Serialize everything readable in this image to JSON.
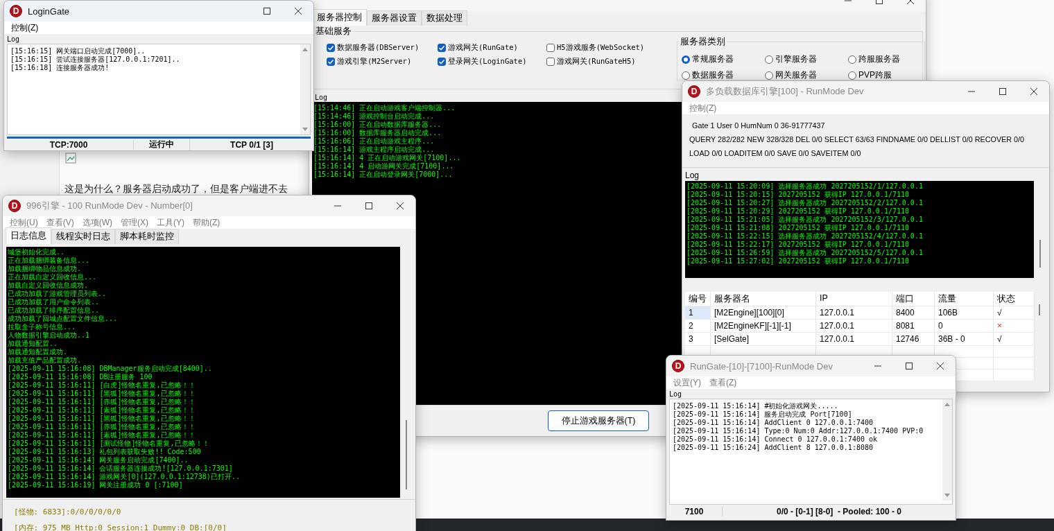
{
  "background_page": {
    "question": "这是为什么？服务器启动成功了，但是客户端进不去"
  },
  "game_center": {
    "minimize": true,
    "tabs": [
      {
        "label": "服务器控制",
        "selected": true
      },
      {
        "label": "服务器设置",
        "selected": false
      },
      {
        "label": "数据处理",
        "selected": false
      }
    ],
    "basic_group": {
      "title": "基础服务",
      "services": [
        {
          "label": "数据服务器(DBServer)",
          "checked": true
        },
        {
          "label": "游戏网关(RunGate)",
          "checked": true
        },
        {
          "label": "H5游戏服务(WebSocket)",
          "checked": false
        },
        {
          "label": "游戏引擎(M2Server)",
          "checked": true
        },
        {
          "label": "登录网关(LoginGate)",
          "checked": true
        },
        {
          "label": "游戏网关(RunGateH5)",
          "checked": false
        }
      ]
    },
    "type_group": {
      "title": "服务器类别",
      "options": [
        {
          "label": "常规服务器",
          "selected": true
        },
        {
          "label": "引擎服务器",
          "selected": false
        },
        {
          "label": "跨服服务器",
          "selected": false
        },
        {
          "label": "数据服务器",
          "selected": false
        },
        {
          "label": "网关服务器",
          "selected": false
        },
        {
          "label": "PVP跨服",
          "selected": false
        }
      ]
    },
    "log_label": "Log",
    "log": [
      "[15:14:46] 正在启动游戏客户端控制器...",
      "[15:14:46] 游戏控制台启动完成...",
      "[15:16:00] 正在启动数据库服务器...",
      "[15:16:00] 数据库服务器启动完成...",
      "[15:16:06] 正在启动游戏主程序...",
      "[15:16:14] 游戏主程序启动完成...",
      "[15:16:14] 4 正在启动游戏网关[7100]...",
      "[15:16:14] 4 启动游网关完成[7100]...",
      "[15:16:14] 正在启动登录网关[7000]..."
    ],
    "stop_button": "停止游戏服务器(T)"
  },
  "login_gate": {
    "title": "LoginGate",
    "logo": "D",
    "active": true,
    "minimize": false,
    "menu": [
      "控制(Z)"
    ],
    "log_label": "Log",
    "log": [
      "[15:16:15] 网关端口启动完成[7000]..",
      "[15:16:15] 尝试连接服务器[127.0.0.1:7201]..",
      "[15:16:18] 连接服务器成功!"
    ],
    "status_bar": [
      "TCP:7000",
      "运行中",
      "TCP 0/1 [3]"
    ]
  },
  "engine": {
    "title": "996引擎 - 100 RunMode Dev - Number[0]",
    "logo": "D",
    "active": false,
    "minimize": true,
    "menu": [
      "控制(U)",
      "查看(V)",
      "选项(W)",
      "管理(X)",
      "工具(Y)",
      "帮助(Z)"
    ],
    "tabs": [
      {
        "label": "日志信息",
        "selected": true
      },
      {
        "label": "线程实时日志",
        "selected": false
      },
      {
        "label": "脚本耗时监控",
        "selected": false
      }
    ],
    "log": [
      "城堡初始化完成..",
      "正在加载捆绑装备信息...",
      "加载捆绑物品信息成功.",
      "正在加载自定义回收信息...",
      "加载自定义回收信息成功.",
      "已成功加载了游戏管理员列表..",
      "已成功加载了用户命令列表..",
      "已成功加载了排序配置信息..",
      "成功加载了回城点配置文件信息...",
      "拉取盒子称号信息...",
      "人物数据引擎启动成功..1",
      "加载通知配置..",
      "加载通知配置成功.",
      "加载充值产品配置成功.",
      "[2025-09-11 15:16:08] DBManager服务启动完成[8400]..",
      "[2025-09-11 15:16:08] DB注册服务 100",
      "[2025-09-11 15:16:11] [白虎]怪物名重复,已忽略！！",
      "[2025-09-11 15:16:11] [黑狐]怪物名重复,已忽略！！",
      "[2025-09-11 15:16:11] [赤狐]怪物名重复,已忽略！！",
      "[2025-09-11 15:16:11] [素狐]怪物名重复,已忽略！！",
      "[2025-09-11 15:16:11] [黑狐]怪物名重复,已忽略！！",
      "[2025-09-11 15:16:11] [赤狐]怪物名重复,已忽略！！",
      "[2025-09-11 15:16:11] [素狐]怪物名重复,已忽略！！",
      "[2025-09-11 15:16:11] [测试怪物]怪物名重复,已忽略！！",
      "[2025-09-11 15:16:13] 礼包列表获取失败!! Code:500",
      "[2025-09-11 15:16:14] 网关服务启动完成[7400]..",
      "[2025-09-11 15:16:14] 会话服务器连接成功![127.0.0.1:7301]",
      "[2025-09-11 15:16:14] 游戏网关[0](127.0.0.1:12738)已打开..",
      "[2025-09-11 15:16:19] 网关注册成功 0 [:7100]"
    ],
    "status_lines": [
      "[怪物: 6833]:0/0/0/0/0/0",
      "[内存: 975 MB Http:0 Session:1 Dummy:0 DB:[0/0]"
    ]
  },
  "db_engine": {
    "title": "多负载数据库引擎[100] - RunMode Dev",
    "logo": "D",
    "active": false,
    "minimize": true,
    "menu": [
      "控制(Z)"
    ],
    "stats": [
      "Gate 1 User 0 HumNum 0 36-91777437",
      "QUERY 282/282 NEW 328/328 DEL 0/0 SELECT 63/63 FINDNAME 0/0 DELLIST 0/0 RECOVER 0/0",
      "LOAD 0/0 LOADITEM 0/0 SAVE 0/0 SAVEITEM 0/0"
    ],
    "log_label": "Log",
    "log": [
      "[2025-09-11 15:20:09] 选择服务器成功 2027205152/1/127.0.0.1",
      "[2025-09-11 15:20:15] 2027205152 获得IP 127.0.0.1/7110",
      "[2025-09-11 15:20:27] 选择服务器成功 2027205152/2/127.0.0.1",
      "[2025-09-11 15:20:29] 2027205152 获得IP 127.0.0.1/7110",
      "[2025-09-11 15:21:05] 选择服务器成功 2027205152/3/127.0.0.1",
      "[2025-09-11 15:21:08] 2027205152 获得IP 127.0.0.1/7110",
      "[2025-09-11 15:22:15] 选择服务器成功 2027205152/4/127.0.0.1",
      "[2025-09-11 15:22:17] 2027205152 获得IP 127.0.0.1/7110",
      "[2025-09-11 15:26:59] 选择服务器成功 2027205152/5/127.0.0.1",
      "[2025-09-11 15:27:02] 2027205152 获得IP 127.0.0.1/7110"
    ],
    "table": {
      "columns": [
        "编号",
        "服务器名",
        "IP",
        "端口",
        "流量",
        "状态"
      ],
      "rows": [
        {
          "cells": [
            "1",
            "[M2Engine][100][0]",
            "127.0.0.1",
            "8400",
            "106B",
            "√"
          ],
          "selected": true,
          "ok": true
        },
        {
          "cells": [
            "2",
            "[M2EngineKF][-1][-1]",
            "127.0.0.1",
            "8081",
            "0",
            "×"
          ],
          "selected": false,
          "ok": false
        },
        {
          "cells": [
            "3",
            "[SelGate]",
            "127.0.0.1",
            "12746",
            "36B - 0",
            "√"
          ],
          "selected": false,
          "ok": true
        }
      ]
    }
  },
  "run_gate": {
    "title": "RunGate-[10]-[7100]-RunMode Dev",
    "logo": "D",
    "active": false,
    "minimize": true,
    "menu": [
      "设置(Y)",
      "查看(Z)"
    ],
    "log_label": "Log",
    "log": [
      "[2025-09-11 15:16:14] #初始化游戏网关.....",
      "[2025-09-11 15:16:14] 服务启动完成 Port[7100]",
      "[2025-09-11 15:16:14] AddClient 0 127.0.0.1:7400",
      "[2025-09-11 15:16:14] Type:0 Num:0 Addr:127.0.0.1:7400 PVP:0",
      "[2025-09-11 15:16:14] Connect 0 127.0.0.1:7400 ok",
      "[2025-09-11 15:16:24] AddClient 8 127.0.0.1:8080"
    ],
    "status_bar": [
      "7100",
      "0/0 - [0-1] [8-0]  - Pooled: 100 - 0"
    ]
  }
}
